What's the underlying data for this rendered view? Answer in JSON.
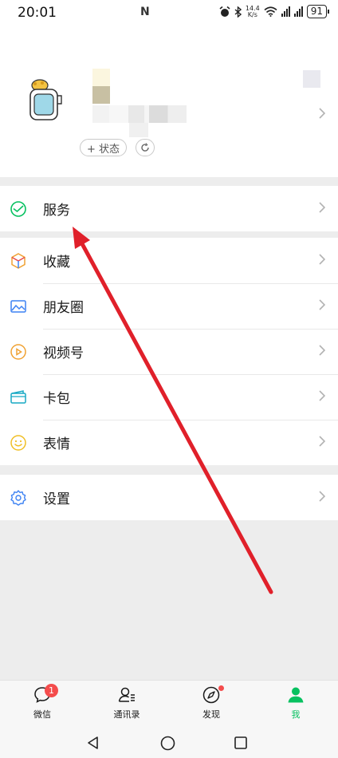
{
  "status_bar": {
    "time": "20:01",
    "nfc": "N",
    "speed_top": "14.4",
    "speed_bottom": "K/s",
    "battery": "91"
  },
  "profile": {
    "status_label": "+ 状态"
  },
  "menu": {
    "services": "服务",
    "favorites": "收藏",
    "moments": "朋友圈",
    "channels": "视频号",
    "cards": "卡包",
    "stickers": "表情",
    "settings": "设置"
  },
  "tabs": [
    {
      "label": "微信",
      "badge": "1"
    },
    {
      "label": "通讯录"
    },
    {
      "label": "发现"
    },
    {
      "label": "我"
    }
  ],
  "colors": {
    "accent": "#07c160",
    "badge": "#f44c4c",
    "arrow": "#e0202a"
  }
}
